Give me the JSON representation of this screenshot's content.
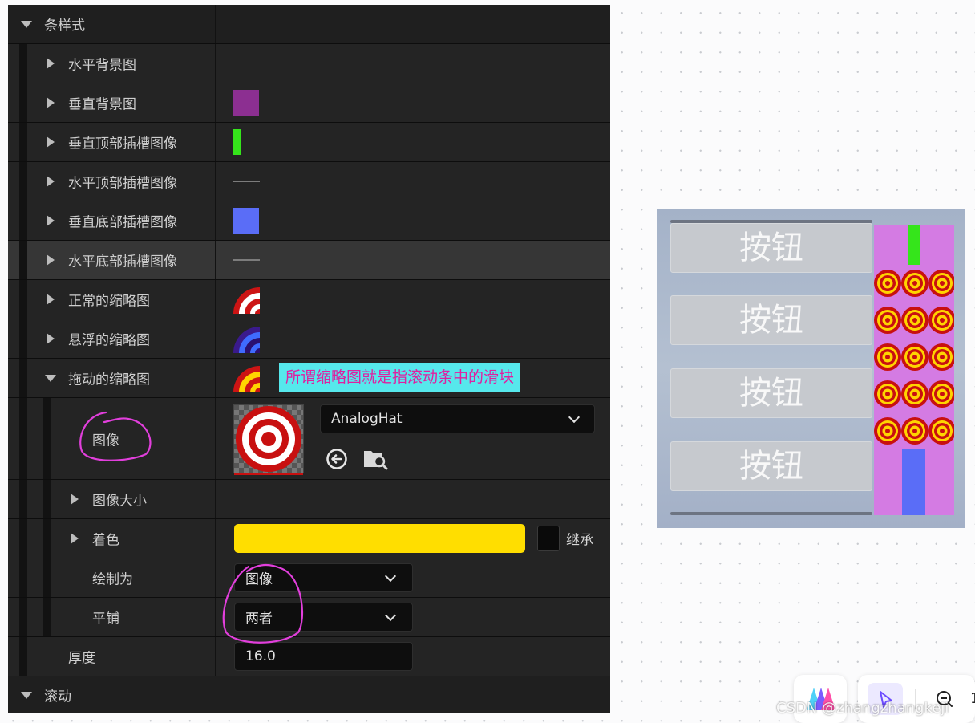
{
  "panel": {
    "section_bar_style": "条样式",
    "horizontal_bg": "水平背景图",
    "vertical_bg": "垂直背景图",
    "vertical_top_slot": "垂直顶部插槽图像",
    "horizontal_top_slot": "水平顶部插槽图像",
    "vertical_bottom_slot": "垂直底部插槽图像",
    "horizontal_bottom_slot": "水平底部插槽图像",
    "normal_thumb": "正常的缩略图",
    "hovered_thumb": "悬浮的缩略图",
    "dragged_thumb": "拖动的缩略图",
    "annotation": "所谓缩略图就是指滚动条中的滑块",
    "image_label": "图像",
    "image_asset": "AnalogHat",
    "image_size": "图像大小",
    "tint": "着色",
    "inherit": "继承",
    "draw_as": "绘制为",
    "draw_as_value": "图像",
    "tiling": "平铺",
    "tiling_value": "两者",
    "thickness": "厚度",
    "thickness_value": "16.0",
    "section_scroll": "滚动"
  },
  "colors": {
    "vertical_bg_swatch": "#8c2f91",
    "vertical_top_slot_swatch": "#35e51b",
    "vertical_bottom_slot_swatch": "#5a6df7",
    "tint": "#ffde00",
    "annotation_bg": "#56e8ec",
    "annotation_text": "#e01fa0",
    "scroll_track": "#d47be3",
    "highlight_circle": "#e23fdc"
  },
  "preview": {
    "buttons": [
      "按钮",
      "按钮",
      "按钮",
      "按钮"
    ]
  },
  "footer": {
    "watermark": "CSDN @zhangzhangkeji",
    "zoom_partial": "1"
  },
  "icons": [
    "triangle-right-icon",
    "triangle-down-icon",
    "chevron-down-icon",
    "reset-arrow-icon",
    "browse-folder-icon",
    "zoom-out-icon",
    "pointer-icon",
    "app-logo-icon"
  ]
}
